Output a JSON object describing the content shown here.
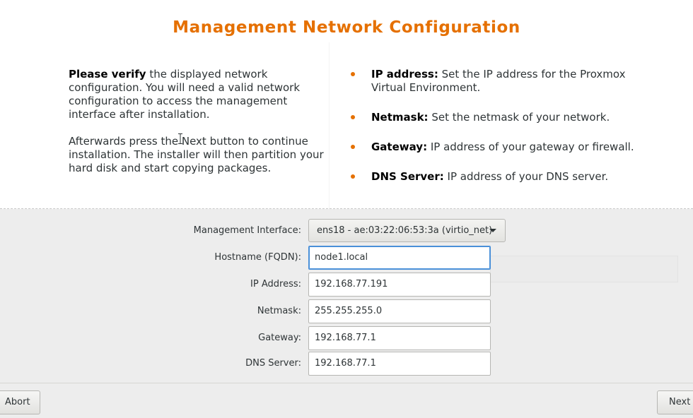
{
  "header": {
    "title": "Management Network Configuration"
  },
  "info": {
    "left": [
      {
        "bold": "Please verify",
        "text": " the displayed network configuration. You will need a valid network configuration to access the management interface after installation."
      },
      {
        "text": "Afterwards press the Next button to continue installation. The installer will then partition your hard disk and start copying packages."
      }
    ],
    "bullets": [
      {
        "term": "IP address:",
        "desc": " Set the IP address for the Proxmox Virtual Environment."
      },
      {
        "term": "Netmask:",
        "desc": " Set the netmask of your network."
      },
      {
        "term": "Gateway:",
        "desc": " IP address of your gateway or firewall."
      },
      {
        "term": "DNS Server:",
        "desc": " IP address of your DNS server."
      }
    ]
  },
  "form": {
    "interface": {
      "label": "Management Interface:",
      "value": "ens18 - ae:03:22:06:53:3a (virtio_net)"
    },
    "hostname": {
      "label": "Hostname (FQDN):",
      "value": "node1.local"
    },
    "ip": {
      "label": "IP Address:",
      "value": "192.168.77.191"
    },
    "netmask": {
      "label": "Netmask:",
      "value": "255.255.255.0"
    },
    "gateway": {
      "label": "Gateway:",
      "value": "192.168.77.1"
    },
    "dns": {
      "label": "DNS Server:",
      "value": "192.168.77.1"
    }
  },
  "buttons": {
    "abort": "Abort",
    "next": "Next"
  },
  "colors": {
    "accent": "#e57000",
    "focus": "#4a90d9"
  },
  "icons": {
    "dropdown": "chevron-down-icon",
    "bullet": "bullet-icon",
    "cursor": "text-cursor-icon"
  }
}
